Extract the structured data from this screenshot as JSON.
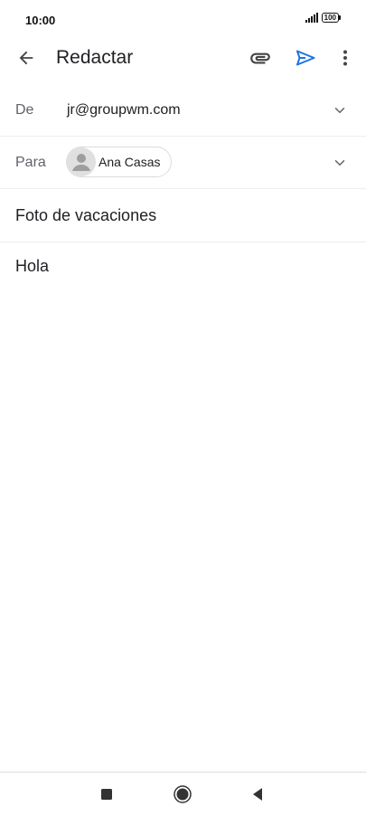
{
  "status_bar": {
    "time": "10:00",
    "battery": "100",
    "icons": [
      "signal-icon",
      "battery-icon"
    ]
  },
  "app_bar": {
    "title": "Redactar",
    "icons": [
      "back-arrow-icon",
      "attachment-icon",
      "send-icon",
      "more-vert-icon"
    ],
    "send_color": "#1a73e8"
  },
  "compose": {
    "from": {
      "label": "De",
      "value": "jr@groupwm.com"
    },
    "to": {
      "label": "Para",
      "recipients": [
        {
          "name": "Ana Casas"
        }
      ]
    },
    "subject": "Foto de vacaciones",
    "body": "Hola"
  },
  "nav_bar": {
    "icons": [
      "recent-apps-icon",
      "home-icon",
      "back-icon"
    ]
  }
}
